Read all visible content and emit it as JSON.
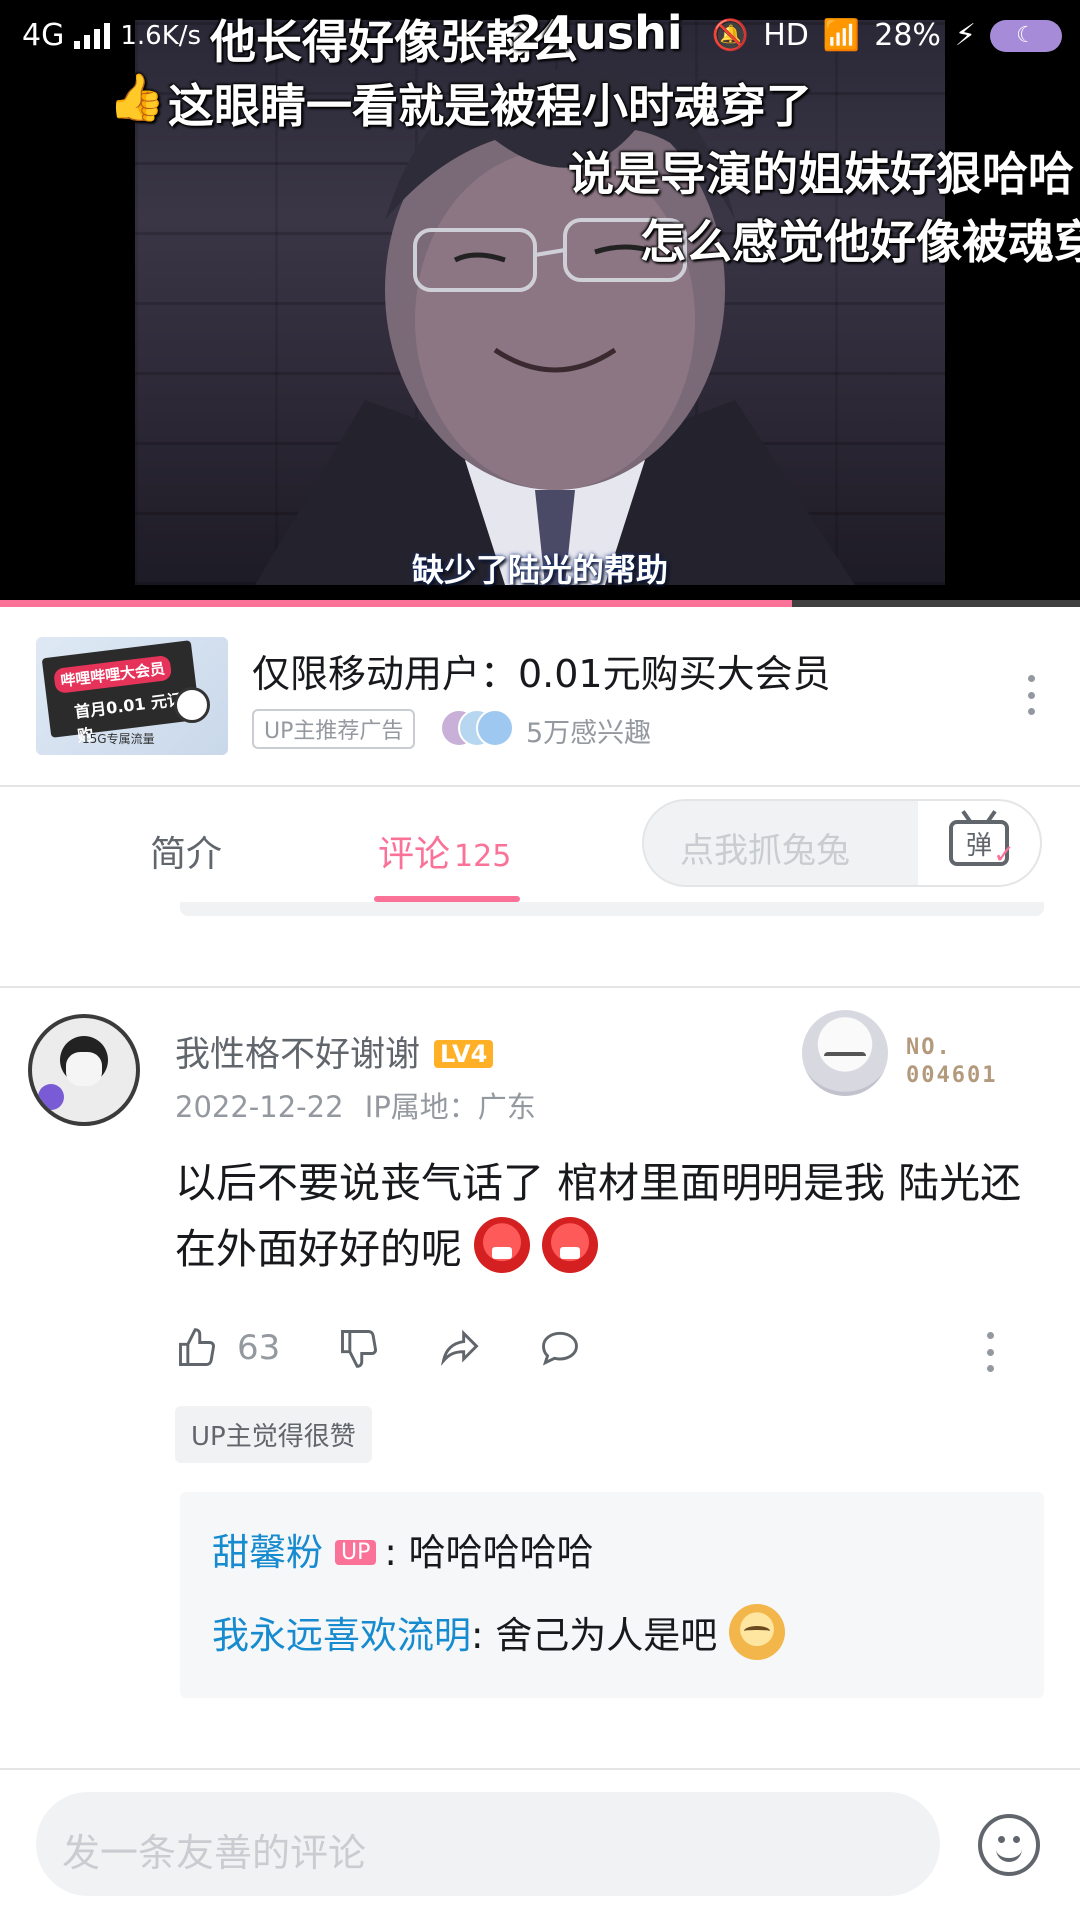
{
  "status_bar": {
    "network": "4G",
    "speed": "1.6K/s",
    "hd": "HD",
    "battery": "28%"
  },
  "video": {
    "progress": 0.733,
    "danmaku": [
      {
        "text": "他长得好像张翰么"
      },
      {
        "text": "这眼睛一看就是被程小时魂穿了"
      },
      {
        "text": "说是导演的姐妹好狠哈哈"
      },
      {
        "text": "怎么感觉他好像被魂穿"
      },
      {
        "text": "24ushi"
      }
    ],
    "subtitle": "缺少了陆光的帮助"
  },
  "ad": {
    "title": "仅限移动用户：0.01元购买大会员",
    "tag": "UP主推荐广告",
    "interest": "5万感兴趣",
    "thumb_line1": "哔哩哔哩大会员",
    "thumb_line2": "首月0.01 元订购",
    "thumb_line3": "15G专属流量"
  },
  "tabs": {
    "intro": "简介",
    "comments": "评论",
    "comment_count": "125",
    "danmaku_placeholder": "点我抓兔兔",
    "danmaku_button": "弹"
  },
  "comment": {
    "username": "我性格不好谢谢",
    "level": "LV4",
    "date": "2022-12-22",
    "ip": "IP属地：广东",
    "badge_no": "NO.",
    "badge_num": "004601",
    "text": "以后不要说丧气话了 棺材里面明明是我 陆光还在外面好好的呢",
    "likes": "63",
    "up_liked": "UP主觉得很赞",
    "replies": [
      {
        "name": "甜馨粉",
        "up": "UP",
        "text": ": 哈哈哈哈哈"
      },
      {
        "name": "我永远喜欢流明",
        "text": ": 舍己为人是吧"
      }
    ]
  },
  "bottom": {
    "placeholder": "发一条友善的评论"
  },
  "colors": {
    "accent": "#fb7299",
    "link": "#178bcf",
    "muted": "#9499a0"
  }
}
